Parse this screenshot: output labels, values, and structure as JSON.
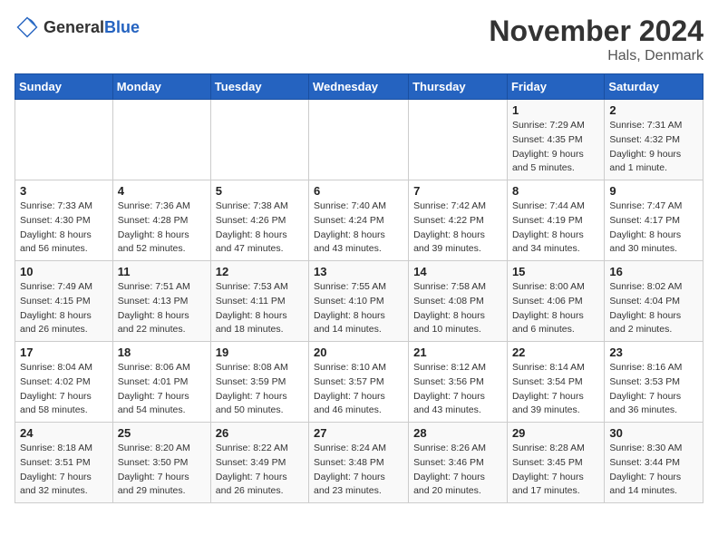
{
  "logo": {
    "general": "General",
    "blue": "Blue"
  },
  "title": "November 2024",
  "location": "Hals, Denmark",
  "days_of_week": [
    "Sunday",
    "Monday",
    "Tuesday",
    "Wednesday",
    "Thursday",
    "Friday",
    "Saturday"
  ],
  "weeks": [
    [
      {
        "day": "",
        "info": ""
      },
      {
        "day": "",
        "info": ""
      },
      {
        "day": "",
        "info": ""
      },
      {
        "day": "",
        "info": ""
      },
      {
        "day": "",
        "info": ""
      },
      {
        "day": "1",
        "info": "Sunrise: 7:29 AM\nSunset: 4:35 PM\nDaylight: 9 hours and 5 minutes."
      },
      {
        "day": "2",
        "info": "Sunrise: 7:31 AM\nSunset: 4:32 PM\nDaylight: 9 hours and 1 minute."
      }
    ],
    [
      {
        "day": "3",
        "info": "Sunrise: 7:33 AM\nSunset: 4:30 PM\nDaylight: 8 hours and 56 minutes."
      },
      {
        "day": "4",
        "info": "Sunrise: 7:36 AM\nSunset: 4:28 PM\nDaylight: 8 hours and 52 minutes."
      },
      {
        "day": "5",
        "info": "Sunrise: 7:38 AM\nSunset: 4:26 PM\nDaylight: 8 hours and 47 minutes."
      },
      {
        "day": "6",
        "info": "Sunrise: 7:40 AM\nSunset: 4:24 PM\nDaylight: 8 hours and 43 minutes."
      },
      {
        "day": "7",
        "info": "Sunrise: 7:42 AM\nSunset: 4:22 PM\nDaylight: 8 hours and 39 minutes."
      },
      {
        "day": "8",
        "info": "Sunrise: 7:44 AM\nSunset: 4:19 PM\nDaylight: 8 hours and 34 minutes."
      },
      {
        "day": "9",
        "info": "Sunrise: 7:47 AM\nSunset: 4:17 PM\nDaylight: 8 hours and 30 minutes."
      }
    ],
    [
      {
        "day": "10",
        "info": "Sunrise: 7:49 AM\nSunset: 4:15 PM\nDaylight: 8 hours and 26 minutes."
      },
      {
        "day": "11",
        "info": "Sunrise: 7:51 AM\nSunset: 4:13 PM\nDaylight: 8 hours and 22 minutes."
      },
      {
        "day": "12",
        "info": "Sunrise: 7:53 AM\nSunset: 4:11 PM\nDaylight: 8 hours and 18 minutes."
      },
      {
        "day": "13",
        "info": "Sunrise: 7:55 AM\nSunset: 4:10 PM\nDaylight: 8 hours and 14 minutes."
      },
      {
        "day": "14",
        "info": "Sunrise: 7:58 AM\nSunset: 4:08 PM\nDaylight: 8 hours and 10 minutes."
      },
      {
        "day": "15",
        "info": "Sunrise: 8:00 AM\nSunset: 4:06 PM\nDaylight: 8 hours and 6 minutes."
      },
      {
        "day": "16",
        "info": "Sunrise: 8:02 AM\nSunset: 4:04 PM\nDaylight: 8 hours and 2 minutes."
      }
    ],
    [
      {
        "day": "17",
        "info": "Sunrise: 8:04 AM\nSunset: 4:02 PM\nDaylight: 7 hours and 58 minutes."
      },
      {
        "day": "18",
        "info": "Sunrise: 8:06 AM\nSunset: 4:01 PM\nDaylight: 7 hours and 54 minutes."
      },
      {
        "day": "19",
        "info": "Sunrise: 8:08 AM\nSunset: 3:59 PM\nDaylight: 7 hours and 50 minutes."
      },
      {
        "day": "20",
        "info": "Sunrise: 8:10 AM\nSunset: 3:57 PM\nDaylight: 7 hours and 46 minutes."
      },
      {
        "day": "21",
        "info": "Sunrise: 8:12 AM\nSunset: 3:56 PM\nDaylight: 7 hours and 43 minutes."
      },
      {
        "day": "22",
        "info": "Sunrise: 8:14 AM\nSunset: 3:54 PM\nDaylight: 7 hours and 39 minutes."
      },
      {
        "day": "23",
        "info": "Sunrise: 8:16 AM\nSunset: 3:53 PM\nDaylight: 7 hours and 36 minutes."
      }
    ],
    [
      {
        "day": "24",
        "info": "Sunrise: 8:18 AM\nSunset: 3:51 PM\nDaylight: 7 hours and 32 minutes."
      },
      {
        "day": "25",
        "info": "Sunrise: 8:20 AM\nSunset: 3:50 PM\nDaylight: 7 hours and 29 minutes."
      },
      {
        "day": "26",
        "info": "Sunrise: 8:22 AM\nSunset: 3:49 PM\nDaylight: 7 hours and 26 minutes."
      },
      {
        "day": "27",
        "info": "Sunrise: 8:24 AM\nSunset: 3:48 PM\nDaylight: 7 hours and 23 minutes."
      },
      {
        "day": "28",
        "info": "Sunrise: 8:26 AM\nSunset: 3:46 PM\nDaylight: 7 hours and 20 minutes."
      },
      {
        "day": "29",
        "info": "Sunrise: 8:28 AM\nSunset: 3:45 PM\nDaylight: 7 hours and 17 minutes."
      },
      {
        "day": "30",
        "info": "Sunrise: 8:30 AM\nSunset: 3:44 PM\nDaylight: 7 hours and 14 minutes."
      }
    ]
  ]
}
